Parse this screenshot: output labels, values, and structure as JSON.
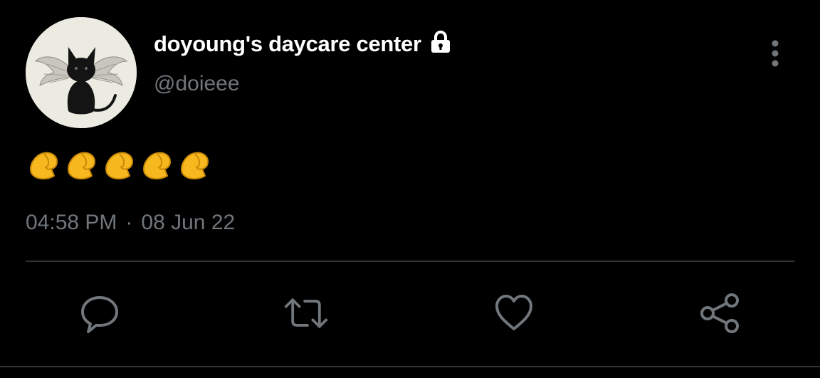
{
  "user": {
    "display_name": "doyoung's daycare center",
    "handle": "@doieee",
    "protected_icon": "lock-icon",
    "avatar_icon": "winged-black-cat-avatar"
  },
  "tweet": {
    "text_emoji": "pinched-fingers-emoji",
    "emoji_count": 5,
    "time": "04:58 PM",
    "separator": "·",
    "date": "08 Jun 22"
  },
  "actions": [
    {
      "name": "reply",
      "icon": "reply-icon"
    },
    {
      "name": "retweet",
      "icon": "retweet-icon"
    },
    {
      "name": "like",
      "icon": "heart-icon"
    },
    {
      "name": "share",
      "icon": "share-icon"
    }
  ],
  "menu": {
    "icon": "more-vertical-icon"
  },
  "colors": {
    "background": "#000000",
    "primary_text": "#ffffff",
    "secondary_text": "#71767b",
    "divider": "#2f3336",
    "emoji_yellow": "#f7b81f"
  }
}
